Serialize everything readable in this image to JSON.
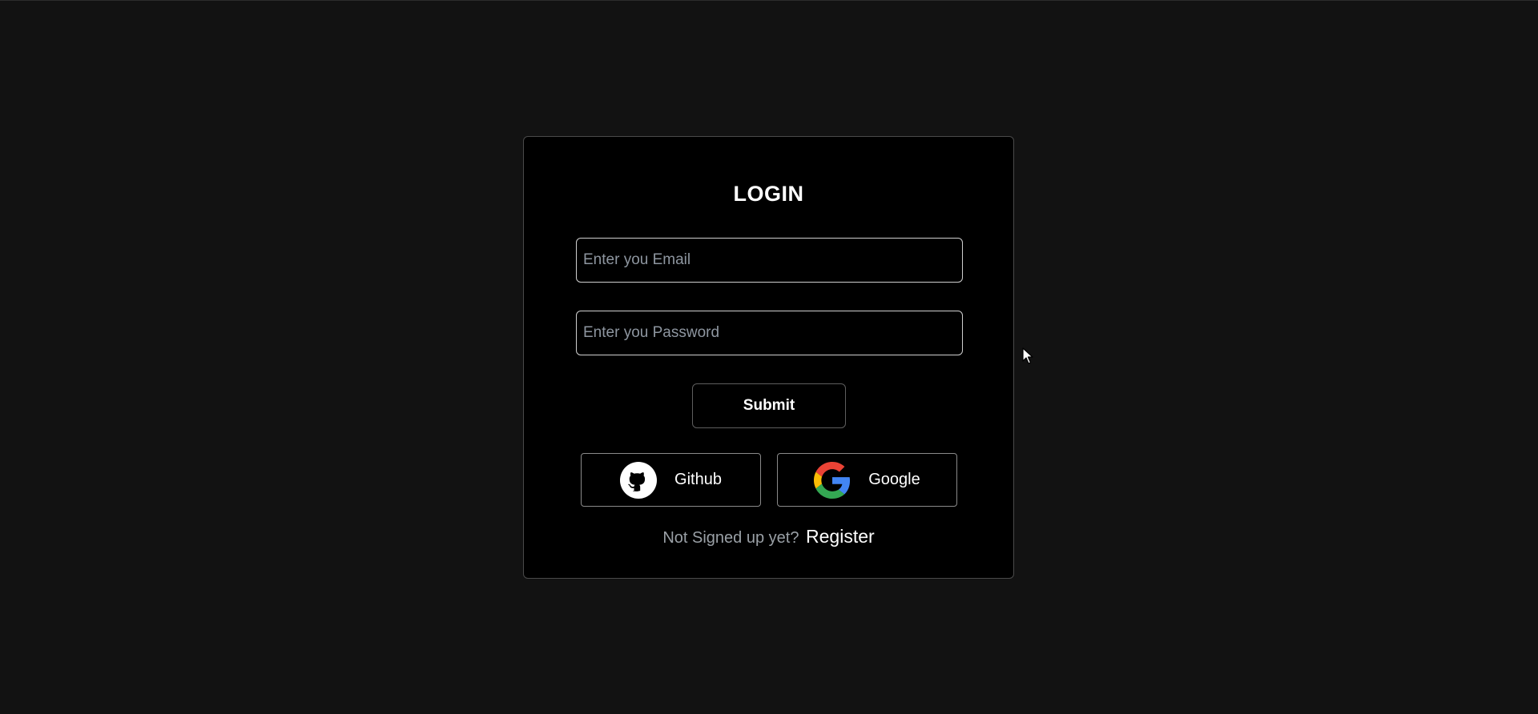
{
  "login": {
    "title": "LOGIN",
    "email_placeholder": "Enter you Email",
    "password_placeholder": "Enter you Password",
    "submit_label": "Submit"
  },
  "social": {
    "github_label": "Github",
    "google_label": "Google"
  },
  "footer": {
    "prompt": "Not Signed up yet?",
    "register_label": "Register"
  },
  "icons": {
    "github": "github-octocat-icon",
    "google": "google-g-icon",
    "cursor": "mouse-pointer-icon"
  },
  "colors": {
    "page_background": "#121212",
    "card_background": "#000000",
    "text": "#ffffff",
    "muted_text": "#9aa0a6",
    "google_blue": "#4285F4",
    "google_green": "#34A853",
    "google_yellow": "#FBBC05",
    "google_red": "#EA4335"
  }
}
